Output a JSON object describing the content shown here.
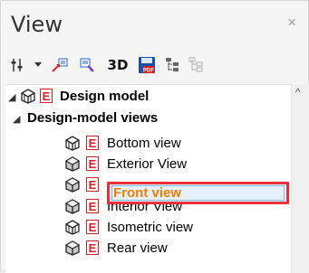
{
  "panel": {
    "title": "View",
    "close_label": "×"
  },
  "toolbar": {
    "items": [
      {
        "name": "filter-options-icon"
      },
      {
        "name": "dropdown-arrow-icon"
      },
      {
        "name": "add-view-icon"
      },
      {
        "name": "view-settings-icon"
      },
      {
        "name": "3d-button",
        "label": "3D"
      },
      {
        "name": "pdf-save-icon"
      },
      {
        "name": "expand-tree-icon"
      },
      {
        "name": "collapse-tree-icon"
      }
    ]
  },
  "tree": {
    "root": {
      "label": "Design model",
      "expanded": true,
      "icon": "cube-icon",
      "badge": "E"
    },
    "group": {
      "label": "Design-model views",
      "expanded": true
    },
    "items": [
      {
        "label": "Bottom view",
        "icon": "cube-icon",
        "badge": "E"
      },
      {
        "label": "Exterior View",
        "icon": "cube-shaded-icon",
        "badge": "E"
      },
      {
        "label": "Front view",
        "icon": "cube-shaded-icon",
        "badge": "E",
        "selected": true
      },
      {
        "label": "Interior View",
        "icon": "cube-shaded-icon",
        "badge": "E"
      },
      {
        "label": "Isometric view",
        "icon": "cube-icon",
        "badge": "E"
      },
      {
        "label": "Rear view",
        "icon": "cube-shaded-icon",
        "badge": "E"
      }
    ]
  },
  "colors": {
    "selection_border": "#e8323b",
    "selected_text": "#ef7d00",
    "badge": "#d0202a"
  }
}
